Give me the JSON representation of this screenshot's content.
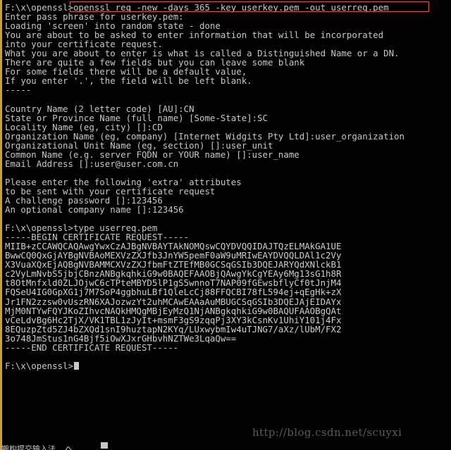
{
  "window": {
    "type": "windows-command-prompt",
    "background_color": "#000000",
    "text_color": "#c8c8c8",
    "highlight_color": "#d95b43",
    "edge_color": "#c8a04a"
  },
  "session": {
    "prompt": "F:\\x\\openssl>",
    "command": "openssl req -new -days 365 -key userkey.pem -out userreq.pem",
    "command_line": "F:\\x\\openssl>openssl req -new -days 365 -key userkey.pem -out userreq.pem",
    "second_prompt_line": "F:\\x\\openssl>type userreq.pem",
    "final_prompt": "F:\\x\\openssl>"
  },
  "output": {
    "lines": [
      "Enter pass phrase for userkey.pem:",
      "Loading 'screen' into random state - done",
      "You are about to be asked to enter information that will be incorporated",
      "into your certificate request.",
      "What you are about to enter is what is called a Distinguished Name or a DN.",
      "There are quite a few fields but you can leave some blank",
      "For some fields there will be a default value,",
      "If you enter '.', the field will be left blank.",
      "-----"
    ]
  },
  "dn_fields": [
    "Country Name (2 letter code) [AU]:CN",
    "State or Province Name (full name) [Some-State]:SC",
    "Locality Name (eg, city) []:CD",
    "Organization Name (eg, company) [Internet Widgits Pty Ltd]:user_organization",
    "Organizational Unit Name (eg, section) []:user_unit",
    "Common Name (e.g. server FQDN or YOUR name) []:user_name",
    "Email Address []:user@user.com.cn"
  ],
  "extra_attributes": {
    "intro_lines": [
      "Please enter the following 'extra' attributes",
      "to be sent with your certificate request"
    ],
    "fields": [
      "A challenge password []:123456",
      "An optional company name []:123456"
    ]
  },
  "certificate": {
    "begin_marker": "-----BEGIN CERTIFICATE REQUEST-----",
    "end_marker": "-----END CERTIFICATE REQUEST-----",
    "body": [
      "MIIB+zCCAWQCAQAwgYwxCzAJBgNVBAYTAkNOMQswCQYDVQQIDAJTQzELMAkGA1UE",
      "BwwCQ0QxGjAYBgNVBAoMEXVzZXJfb3JnYW5pemF0aW9uMRIwEAYDVQQLDAl1c2Vy",
      "X3VuaXQxEjAQBgNVBAMMCXVzZXJfbmFtZTEfMB0GCSqGSIb3DQEJARYQdXNlckB1",
      "c2VyLmNvbS5jbjCBnzANBgkqhkiG9w0BAQEFAAOBjQAwgYkCgYEAy6Mg13sG1h8R",
      "t8OtMnfxld0ZLJOjwC6cTPteMBYD5lP1gS5wnnoT7NAP09fGEwsbflyCf0tJnjM4",
      "FQSeU4IG0GpXG1j7M7SoP4ggbhuLBf1QleLcCj88FFQCBI78fL594ej+qEgHk+zX",
      "Jr1FN2zzsw0vUszRN6XAJozwzYt2uhMCAwEAAaAuMBUGCSqGSIb3DQEJAjEIDAYx",
      "MjM0NTYwFQYJKoZIhvcNAQkHMQgMBjEyMzQ1NjANBgkqhkiG9w0BAQUFAAOBgQAt",
      "vCeLdvBg6Hc2TjX/VK1TBL1zJyIt+msmF3gS9zqqPj3XY3kCsnKv1UhiY101j4Fx",
      "8EQuzpZtd5ZJ4bZXQd1snI9huztapN2KYq/LUxwybmIw4uTJNG7/aXz/lUbM/FX2",
      "3o748JmStus1nG4Bjf5iOwXJxrGHbvhNZTWe3LqaQw=="
    ]
  },
  "watermark": {
    "text": "http://blog.csdn.net/scuyxi"
  },
  "taskbar": {
    "hint": "搬构提交输入法  へ"
  }
}
